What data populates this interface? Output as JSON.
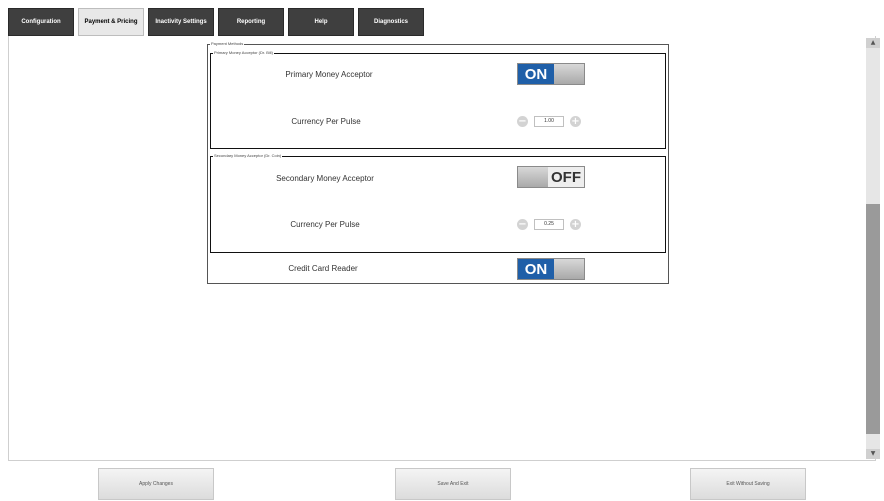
{
  "tabs": [
    {
      "label": "Configuration",
      "active": false
    },
    {
      "label": "Payment & Pricing",
      "active": true
    },
    {
      "label": "Inactivity Settings",
      "active": false
    },
    {
      "label": "Reporting",
      "active": false
    },
    {
      "label": "Help",
      "active": false
    },
    {
      "label": "Diagnostics",
      "active": false
    }
  ],
  "payment_methods": {
    "legend": "Payment Methods",
    "primary_group": {
      "legend": "Primary Money Acceptor (Dr. Bill)",
      "acceptor_label": "Primary Money Acceptor",
      "toggle_text": "ON",
      "toggle_state": "on",
      "currency_label": "Currency Per Pulse",
      "currency_value": "1.00",
      "minus_icon": "minus-circle-icon",
      "plus_icon": "plus-circle-icon"
    },
    "secondary_group": {
      "legend": "Secondary Money Acceptor (Dr. Coin)",
      "acceptor_label": "Secondary Money Acceptor",
      "toggle_text": "OFF",
      "toggle_state": "off",
      "currency_label": "Currency Per Pulse",
      "currency_value": "0.25",
      "minus_icon": "minus-circle-icon",
      "plus_icon": "plus-circle-icon"
    },
    "credit_card": {
      "label": "Credit Card Reader",
      "toggle_text": "ON",
      "toggle_state": "on"
    }
  },
  "bottom_buttons": {
    "apply": "Apply Changes",
    "save_exit": "Save And Exit",
    "exit_without_saving": "Exit Without Saving"
  },
  "colors": {
    "tab_bg": "#3f3f3f",
    "tab_active_bg": "#e8e8e8",
    "toggle_on": "#1f5fa8"
  }
}
